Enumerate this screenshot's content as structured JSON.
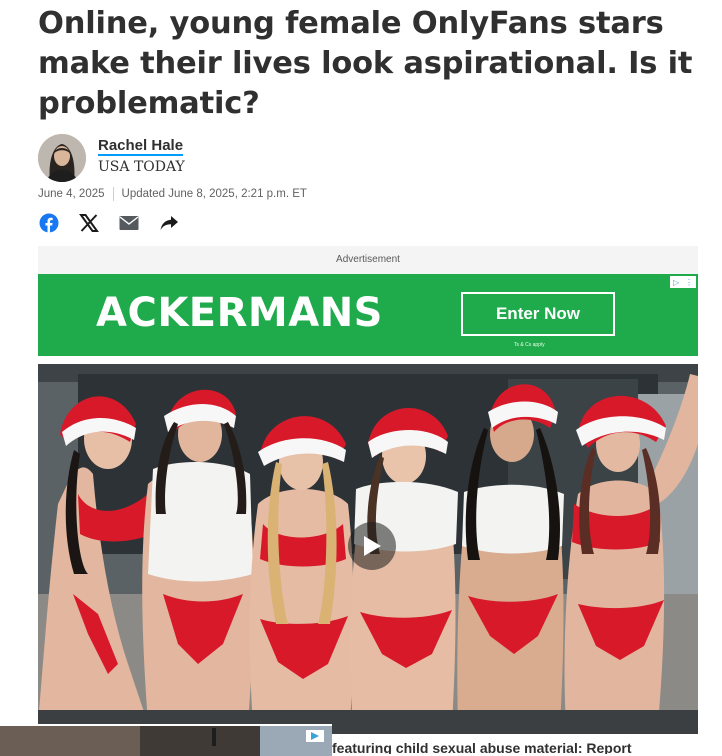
{
  "article": {
    "headline": "Online, young female OnlyFans stars make their lives look aspirational. Is it problematic?",
    "author": "Rachel Hale",
    "publisher": "USA TODAY",
    "published": "June 4, 2025",
    "updated": "Updated June 8, 2025, 2:21 p.m. ET"
  },
  "share": {
    "icons": [
      "facebook-icon",
      "x-icon",
      "email-icon",
      "share-arrow-icon"
    ]
  },
  "ad": {
    "label": "Advertisement",
    "brand": "ACKERMANS",
    "cta": "Enter Now",
    "terms": "Ts & Cs apply",
    "choices_icons": [
      "adchoices-icon",
      "info-icon"
    ]
  },
  "video": {
    "play_icon": "play-icon"
  },
  "related": {
    "caption": "featuring child sexual abuse material: Report"
  },
  "colors": {
    "text": "#303030",
    "link_underline": "#009bff",
    "ad_green": "#1faa4b",
    "facebook_blue": "#1877f2",
    "santa_red": "#d8192a"
  }
}
